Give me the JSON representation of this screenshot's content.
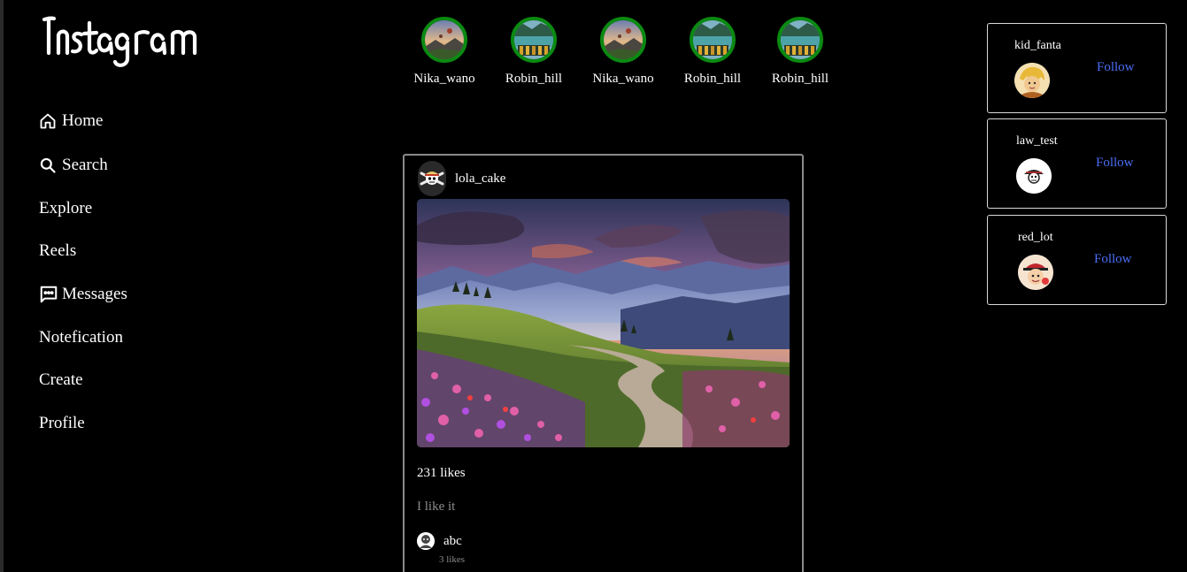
{
  "app": {
    "logo_text": "Instagram"
  },
  "nav": {
    "items": [
      {
        "label": "Home",
        "icon": "home-icon"
      },
      {
        "label": "Search",
        "icon": "search-icon"
      },
      {
        "label": "Explore"
      },
      {
        "label": "Reels"
      },
      {
        "label": "Messages",
        "icon": "message-icon"
      },
      {
        "label": "Notefication"
      },
      {
        "label": "Create"
      },
      {
        "label": "Profile"
      }
    ]
  },
  "stories": [
    {
      "name": "Nika_wano",
      "image": "balloons-landscape"
    },
    {
      "name": "Robin_hill",
      "image": "lake-boats"
    },
    {
      "name": "Nika_wano",
      "image": "balloons-landscape"
    },
    {
      "name": "Robin_hill",
      "image": "lake-boats"
    },
    {
      "name": "Robin_hill",
      "image": "lake-boats"
    }
  ],
  "post": {
    "username": "lola_cake",
    "avatar": "straw-hat-skull-icon",
    "image": "mountain-flower-valley-sunset",
    "likes": "231 likes",
    "caption": "I like it",
    "comment": {
      "username": "abc",
      "likes": "3 likes"
    }
  },
  "suggestions": [
    {
      "username": "kid_fanta",
      "follow_label": "Follow"
    },
    {
      "username": "law_test",
      "follow_label": "Follow"
    },
    {
      "username": "red_lot",
      "follow_label": "Follow"
    }
  ],
  "colors": {
    "background": "#000000",
    "story_ring": "#0b8a12",
    "follow_link": "#4a6ef5",
    "muted_text": "#8c8c8c"
  }
}
